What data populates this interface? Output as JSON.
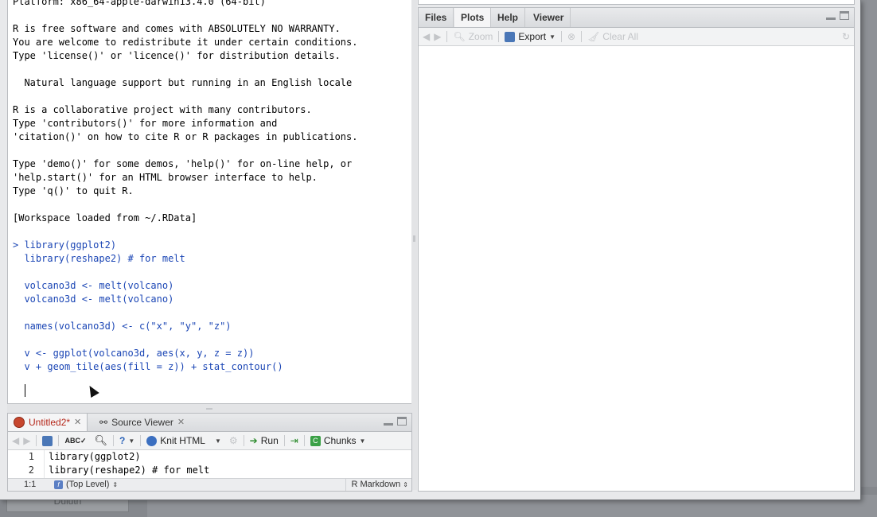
{
  "background": {
    "underlay_tab": "Duluth"
  },
  "console": {
    "lines": [
      {
        "text": "Platform: x86_64-apple-darwin13.4.0 (64-bit)",
        "cmd": false
      },
      {
        "text": "",
        "cmd": false
      },
      {
        "text": "R is free software and comes with ABSOLUTELY NO WARRANTY.",
        "cmd": false
      },
      {
        "text": "You are welcome to redistribute it under certain conditions.",
        "cmd": false
      },
      {
        "text": "Type 'license()' or 'licence()' for distribution details.",
        "cmd": false
      },
      {
        "text": "",
        "cmd": false
      },
      {
        "text": "  Natural language support but running in an English locale",
        "cmd": false
      },
      {
        "text": "",
        "cmd": false
      },
      {
        "text": "R is a collaborative project with many contributors.",
        "cmd": false
      },
      {
        "text": "Type 'contributors()' for more information and",
        "cmd": false
      },
      {
        "text": "'citation()' on how to cite R or R packages in publications.",
        "cmd": false
      },
      {
        "text": "",
        "cmd": false
      },
      {
        "text": "Type 'demo()' for some demos, 'help()' for on-line help, or",
        "cmd": false
      },
      {
        "text": "'help.start()' for an HTML browser interface to help.",
        "cmd": false
      },
      {
        "text": "Type 'q()' to quit R.",
        "cmd": false
      },
      {
        "text": "",
        "cmd": false
      },
      {
        "text": "[Workspace loaded from ~/.RData]",
        "cmd": false
      },
      {
        "text": "",
        "cmd": false
      },
      {
        "text": "> library(ggplot2)",
        "cmd": true
      },
      {
        "text": "  library(reshape2) # for melt",
        "cmd": true
      },
      {
        "text": "",
        "cmd": true
      },
      {
        "text": "  volcano3d <- melt(volcano)",
        "cmd": true
      },
      {
        "text": "  volcano3d <- melt(volcano)",
        "cmd": true
      },
      {
        "text": "",
        "cmd": true
      },
      {
        "text": "  names(volcano3d) <- c(\"x\", \"y\", \"z\")",
        "cmd": true
      },
      {
        "text": "",
        "cmd": true
      },
      {
        "text": "  v <- ggplot(volcano3d, aes(x, y, z = z))",
        "cmd": true
      },
      {
        "text": "  v + geom_tile(aes(fill = z)) + stat_contour()",
        "cmd": true
      }
    ]
  },
  "source": {
    "tabs": [
      {
        "label": "Untitled2*",
        "active": true
      },
      {
        "label": "Source Viewer",
        "active": false
      }
    ],
    "toolbar": {
      "knit": "Knit HTML",
      "run": "Run",
      "chunks": "Chunks"
    },
    "lines": [
      {
        "num": "1",
        "code": "library(ggplot2)"
      },
      {
        "num": "2",
        "code": "library(reshape2) # for melt"
      }
    ],
    "status": {
      "position": "1:1",
      "scope": "(Top Level)",
      "mode": "R Markdown"
    }
  },
  "right_pane": {
    "tabs": [
      "Files",
      "Plots",
      "Help",
      "Viewer"
    ],
    "active_tab": "Plots",
    "toolbar": {
      "zoom": "Zoom",
      "export": "Export",
      "clear_all": "Clear All"
    }
  },
  "colors": {
    "command_text": "#1b46b5",
    "active_source_tab": "#b5271a"
  }
}
